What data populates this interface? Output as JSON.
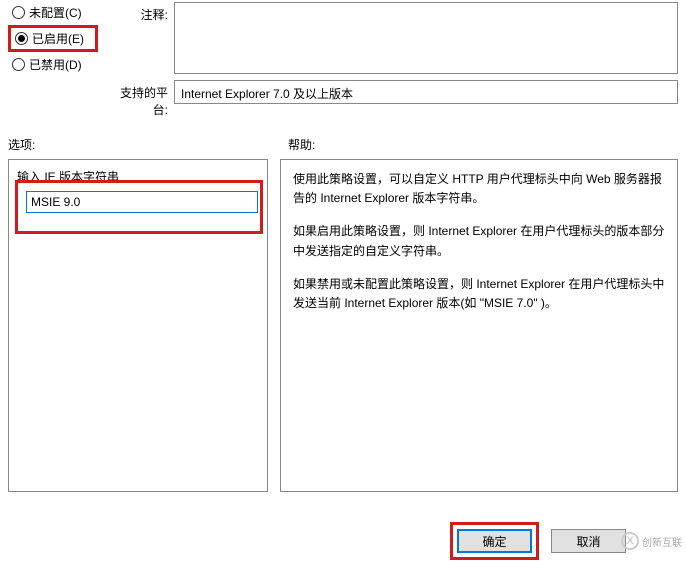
{
  "radios": {
    "not_configured": "未配置(C)",
    "enabled": "已启用(E)",
    "disabled": "已禁用(D)"
  },
  "labels": {
    "comment": "注释:",
    "platform": "支持的平台:",
    "options": "选项:",
    "help": "帮助:",
    "version_string": "输入 IE 版本字符串"
  },
  "values": {
    "platform": "Internet Explorer 7.0 及以上版本",
    "version_input": "MSIE 9.0"
  },
  "help_text": {
    "p1": "使用此策略设置，可以自定义 HTTP 用户代理标头中向 Web 服务器报告的 Internet Explorer 版本字符串。",
    "p2": "如果启用此策略设置，则 Internet Explorer 在用户代理标头的版本部分中发送指定的自定义字符串。",
    "p3": "如果禁用或未配置此策略设置，则 Internet Explorer 在用户代理标头中发送当前 Internet Explorer 版本(如 \"MSIE 7.0\" )。"
  },
  "buttons": {
    "ok": "确定",
    "cancel": "取消"
  },
  "watermark": "创新互联"
}
